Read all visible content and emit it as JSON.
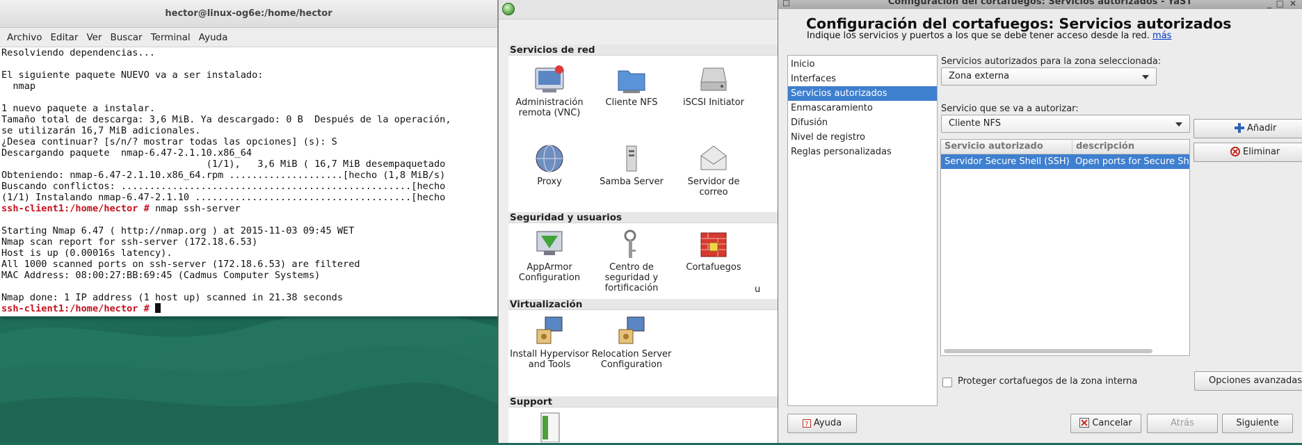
{
  "terminal": {
    "title": "hector@linux-og6e:/home/hector",
    "menu": [
      "Archivo",
      "Editar",
      "Ver",
      "Buscar",
      "Terminal",
      "Ayuda"
    ],
    "lines": [
      {
        "text": "Resolviendo dependencias..."
      },
      {
        "text": ""
      },
      {
        "text": "El siguiente paquete NUEVO va a ser instalado:"
      },
      {
        "text": "  nmap"
      },
      {
        "text": ""
      },
      {
        "text": "1 nuevo paquete a instalar."
      },
      {
        "text": "Tamaño total de descarga: 3,6 MiB. Ya descargado: 0 B  Después de la operación,"
      },
      {
        "text": "se utilizarán 16,7 MiB adicionales."
      },
      {
        "text": "¿Desea continuar? [s/n/? mostrar todas las opciones] (s): S"
      },
      {
        "text": "Descargando paquete  nmap-6.47-2.1.10.x86_64"
      },
      {
        "text": "                                    (1/1),   3,6 MiB ( 16,7 MiB desempaquetado"
      },
      {
        "text": "Obteniendo: nmap-6.47-2.1.10.x86_64.rpm ....................[hecho (1,8 MiB/s)"
      },
      {
        "text": "Buscando conflictos: ...................................................[hecho"
      },
      {
        "text": "(1/1) Instalando nmap-6.47-2.1.10 ......................................[hecho"
      },
      {
        "prompt": "ssh-client1:/home/hector #",
        "text": " nmap ssh-server"
      },
      {
        "text": ""
      },
      {
        "text": "Starting Nmap 6.47 ( http://nmap.org ) at 2015-11-03 09:45 WET"
      },
      {
        "text": "Nmap scan report for ssh-server (172.18.6.53)"
      },
      {
        "text": "Host is up (0.00016s latency)."
      },
      {
        "text": "All 1000 scanned ports on ssh-server (172.18.6.53) are filtered"
      },
      {
        "text": "MAC Address: 08:00:27:BB:69:45 (Cadmus Computer Systems)"
      },
      {
        "text": ""
      },
      {
        "text": "Nmap done: 1 IP address (1 host up) scanned in 21.38 seconds"
      },
      {
        "prompt": "ssh-client1:/home/hector #",
        "text": " ",
        "cursor": true
      }
    ]
  },
  "control_center": {
    "home_icon": "home-icon",
    "sections": [
      {
        "title": "Servicios de red",
        "items": [
          {
            "label": "Administración remota (VNC)",
            "icon": "remote-admin-icon"
          },
          {
            "label": "Cliente NFS",
            "icon": "nfs-folder-icon"
          },
          {
            "label": "iSCSI Initiator",
            "icon": "iscsi-drive-icon"
          },
          {
            "label": "Proxy",
            "icon": "proxy-globe-icon"
          },
          {
            "label": "Samba Server",
            "icon": "samba-server-icon"
          },
          {
            "label": "Servidor de correo",
            "icon": "mail-server-icon"
          }
        ]
      },
      {
        "title": "Seguridad y usuarios",
        "items": [
          {
            "label": "AppArmor Configuration",
            "icon": "apparmor-icon"
          },
          {
            "label": "Centro de seguridad y fortificación",
            "icon": "security-keys-icon"
          },
          {
            "label": "Cortafuegos",
            "icon": "firewall-icon"
          },
          {
            "label": "G\nu",
            "icon": "clipped-item-icon"
          }
        ]
      },
      {
        "title": "Virtualización",
        "items": [
          {
            "label": "Install Hypervisor and Tools",
            "icon": "hypervisor-icon"
          },
          {
            "label": "Relocation Server Configuration",
            "icon": "relocation-server-icon"
          }
        ]
      },
      {
        "title": "Support",
        "items": [
          {
            "label": "",
            "icon": "support-document-icon"
          }
        ]
      }
    ]
  },
  "firewall_dialog": {
    "window_title": "Configuración del cortafuegos: Servicios autorizados - YaST",
    "heading": "Configuración del cortafuegos: Servicios autorizados",
    "subtitle": "Indique los servicios y puertos a los que se debe tener acceso desde la red.",
    "subtitle_link": "más",
    "nav": [
      {
        "label": "Inicio",
        "selected": false
      },
      {
        "label": "Interfaces",
        "selected": false
      },
      {
        "label": "Servicios autorizados",
        "selected": true
      },
      {
        "label": "Enmascaramiento",
        "selected": false
      },
      {
        "label": "Difusión",
        "selected": false
      },
      {
        "label": "Nivel de registro",
        "selected": false
      },
      {
        "label": "Reglas personalizadas",
        "selected": false
      }
    ],
    "zone_label": "Servicios autorizados para la zona seleccionada:",
    "zone_value": "Zona externa",
    "service_label": "Servicio que se va a autorizar:",
    "service_value": "Cliente NFS",
    "add_button": "Añadir",
    "remove_button": "Eliminar",
    "table": {
      "columns": [
        "Servicio autorizado",
        "descripción"
      ],
      "rows": [
        {
          "service": "Servidor Secure Shell (SSH)",
          "description": "Open ports for Secure Shell"
        }
      ]
    },
    "protect_label": "Proteger cortafuegos de la zona interna",
    "protect_checked": false,
    "advanced_button": "Opciones avanzadas...",
    "help_button": "Ayuda",
    "cancel_button": "Cancelar",
    "back_button": "Atrás",
    "next_button": "Siguiente",
    "colors": {
      "selection": "#3e7fcf",
      "prompt": "#c2111d",
      "link": "#0033cc"
    }
  }
}
